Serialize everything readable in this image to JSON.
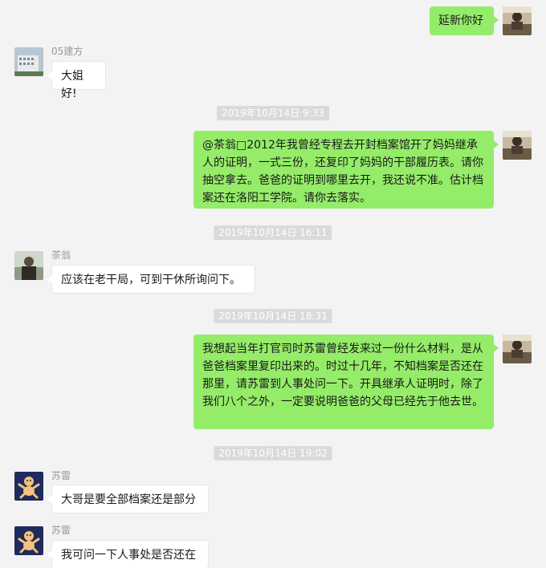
{
  "messages": [
    {
      "sender": "",
      "text": "延新你好"
    },
    {
      "sender": "05建方",
      "text": "大姐好!"
    },
    {
      "timestamp": "2019年10月14日 9:33"
    },
    {
      "sender": "",
      "text": "@茶翁□2012年我曾经专程去开封档案馆开了妈妈继承人的证明，一式三份，还复印了妈妈的干部履历表。请你抽空拿去。爸爸的证明到哪里去开，我还说不准。估计档案还在洛阳工学院。请你去落实。"
    },
    {
      "timestamp": "2019年10月14日 16:11"
    },
    {
      "sender": "茶翁",
      "text": "应该在老干局，可到干休所询问下。"
    },
    {
      "timestamp": "2019年10月14日 18:31"
    },
    {
      "sender": "",
      "text": "我想起当年打官司时苏雷曾经发来过一份什么材料，是从爸爸档案里复印出来的。时过十几年，不知档案是否还在那里，请苏雷到人事处问一下。开具继承人证明时，除了我们八个之外，一定要说明爸爸的父母已经先于他去世。"
    },
    {
      "timestamp": "2019年10月14日 19:02"
    },
    {
      "sender": "苏雷",
      "text": "大哥是要全部档案还是部分"
    },
    {
      "sender": "苏雷",
      "text": "我可问一下人事处是否还在"
    }
  ],
  "colors": {
    "outgoing_bubble": "#95ec69",
    "incoming_bubble": "#ffffff",
    "background": "#f3f3f3",
    "timestamp_bg": "#dadada"
  }
}
